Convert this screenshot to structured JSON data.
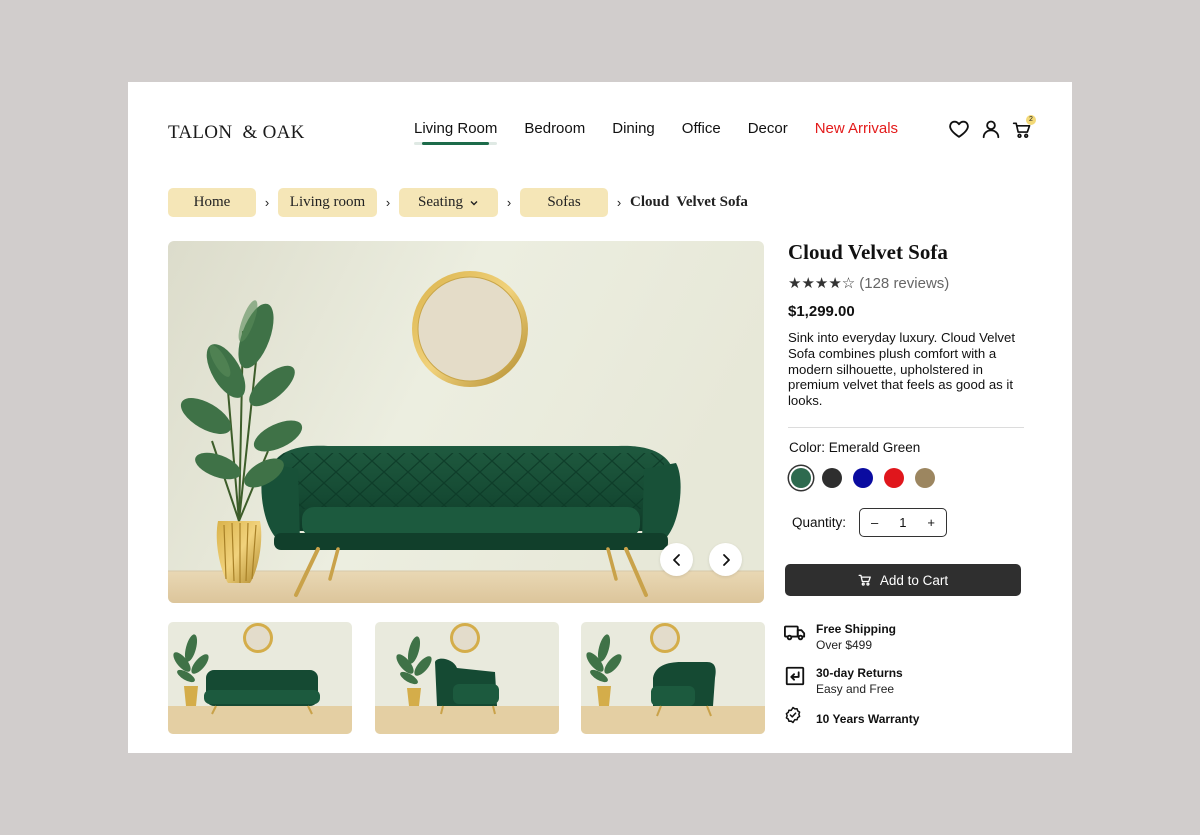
{
  "brand": {
    "logo": "TALON  & OAK"
  },
  "nav": {
    "items": [
      {
        "label": "Living Room",
        "name": "nav-living-room"
      },
      {
        "label": "Bedroom",
        "name": "nav-bedroom"
      },
      {
        "label": "Dining",
        "name": "nav-dining"
      },
      {
        "label": "Office",
        "name": "nav-office"
      },
      {
        "label": "Decor",
        "name": "nav-decor"
      },
      {
        "label": "New Arrivals",
        "name": "nav-new-arrivals"
      }
    ],
    "active": "Living Room",
    "highlight_color": "#e31b1b",
    "active_underline_color": "#1d6b4a"
  },
  "header_icons": {
    "wishlist": "heart-icon",
    "account": "user-icon",
    "cart": "cart-icon",
    "cart_count": "2"
  },
  "breadcrumb": {
    "items": [
      "Home",
      "Living room",
      "Seating",
      "Sofas"
    ],
    "current": "Cloud  Velvet Sofa",
    "pill_color": "#f5e6b7"
  },
  "product": {
    "title": "Cloud Velvet Sofa",
    "rating": 4,
    "rating_max": 5,
    "reviews": "(128 reviews)",
    "price": "$1,299.00",
    "description": "Sink into everyday luxury. Cloud Velvet Sofa combines plush comfort with a modern silhouette, upholstered in premium velvet that feels as good as it looks.",
    "color_label": "Color: Emerald Green",
    "colors": [
      {
        "name": "Emerald Green",
        "hex": "#2e6a4f",
        "selected": true
      },
      {
        "name": "Charcoal",
        "hex": "#2e2e2e",
        "selected": false
      },
      {
        "name": "Navy Blue",
        "hex": "#0a0ba0",
        "selected": false
      },
      {
        "name": "Red",
        "hex": "#e0161c",
        "selected": false
      },
      {
        "name": "Taupe",
        "hex": "#9c8660",
        "selected": false
      }
    ],
    "quantity_label": "Quantity:",
    "quantity": "1",
    "qty_minus": "–",
    "qty_plus": "+",
    "add_to_cart": "Add to Cart"
  },
  "gallery": {
    "main_image": "emerald velvet sofa with round gold mirror and plant",
    "prev_icon": "chevron-left-icon",
    "next_icon": "chevron-right-icon",
    "thumbnails": [
      "sofa-front-view",
      "sofa-angled-view",
      "sofa-side-view"
    ]
  },
  "features": [
    {
      "icon": "truck-icon",
      "title": "Free Shipping",
      "subtitle": "Over $499"
    },
    {
      "icon": "return-icon",
      "title": "30-day Returns",
      "subtitle": "Easy and Free"
    },
    {
      "icon": "badge-check-icon",
      "title": "10 Years Warranty",
      "subtitle": ""
    }
  ]
}
